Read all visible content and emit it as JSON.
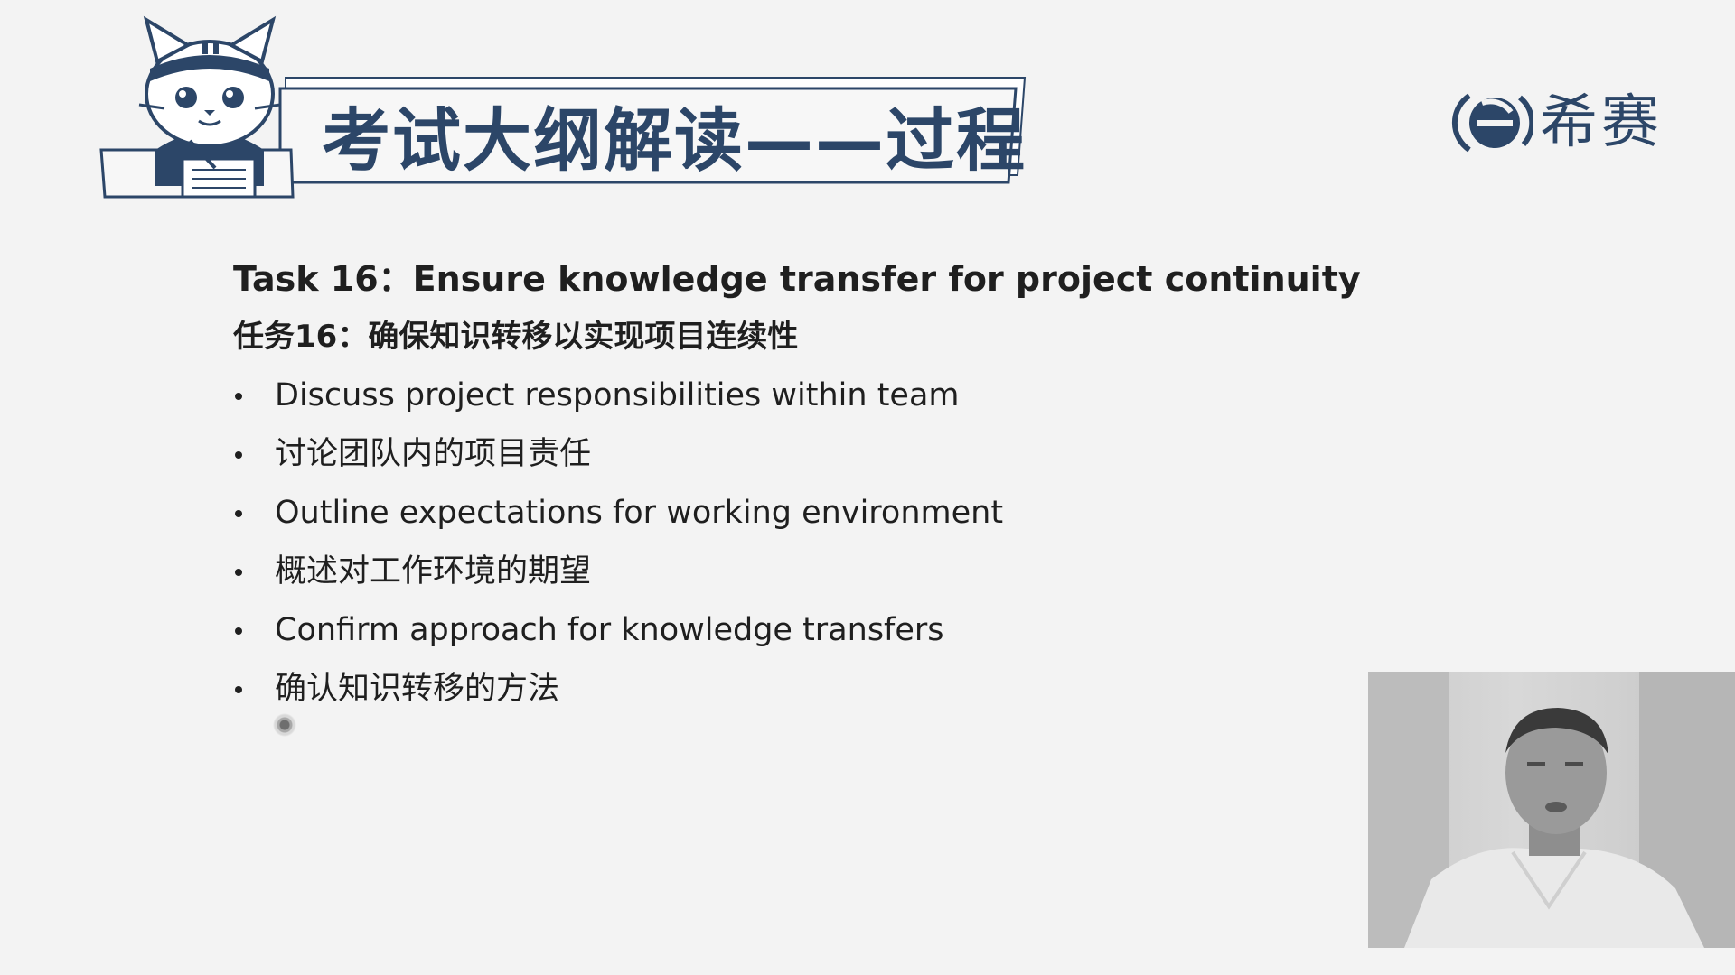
{
  "header": {
    "title": "考试大纲解读——过程",
    "mascot_icon": "cat-mascot-icon"
  },
  "brand": {
    "name": "希赛",
    "mark_icon": "xisai-e-logo-icon",
    "color": "#2c4668"
  },
  "content": {
    "task_title_en": "Task 16：Ensure knowledge transfer for project continuity",
    "task_title_cn": "任务16：确保知识转移以实现项目连续性",
    "bullets": [
      "Discuss project responsibilities within team",
      "讨论团队内的项目责任",
      "Outline expectations for working environment",
      "概述对工作环境的期望",
      "Confirm approach for knowledge transfers",
      "确认知识转移的方法"
    ]
  },
  "colors": {
    "background": "#f3f3f3",
    "accent": "#2c4668",
    "text": "#1f1f1f"
  }
}
